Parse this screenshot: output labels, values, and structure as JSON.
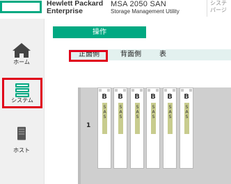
{
  "header": {
    "brand_line1": "Hewlett Packard",
    "brand_line2": "Enterprise",
    "product_name": "MSA 2050 SAN",
    "product_sub": "Storage Management Utility",
    "system_text_line1": "システ",
    "system_text_line2": "パージ"
  },
  "sidebar": {
    "items": [
      {
        "label": "ホーム",
        "icon": "home-icon"
      },
      {
        "label": "システム",
        "icon": "system-icon"
      },
      {
        "label": "ホスト",
        "icon": "host-icon"
      }
    ]
  },
  "main": {
    "operation_label": "操作",
    "tabs": [
      {
        "label": "正面側"
      },
      {
        "label": "背面側"
      },
      {
        "label": "表"
      }
    ],
    "enclosure_number": "1",
    "slots": [
      {
        "letter": "B",
        "type": "SAS"
      },
      {
        "letter": "B",
        "type": "SAS"
      },
      {
        "letter": "B",
        "type": "SAS"
      },
      {
        "letter": "B",
        "type": "SAS"
      },
      {
        "letter": "B",
        "type": "SAS"
      },
      {
        "letter": "B",
        "type": "SAS"
      }
    ]
  },
  "colors": {
    "accent": "#01a982",
    "highlight": "#e0001a",
    "drive_label": "#c8cc8e"
  }
}
